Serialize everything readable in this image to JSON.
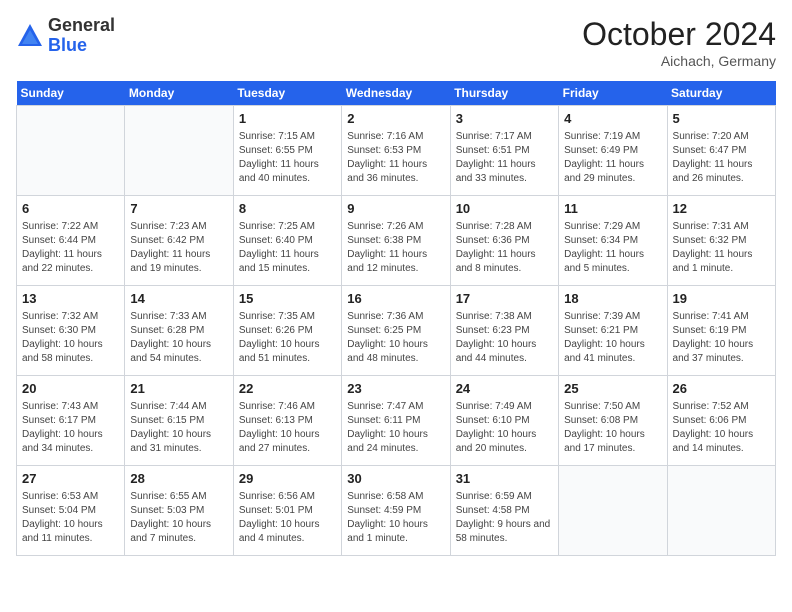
{
  "header": {
    "logo_general": "General",
    "logo_blue": "Blue",
    "month_title": "October 2024",
    "location": "Aichach, Germany"
  },
  "days_of_week": [
    "Sunday",
    "Monday",
    "Tuesday",
    "Wednesday",
    "Thursday",
    "Friday",
    "Saturday"
  ],
  "weeks": [
    [
      {
        "day": "",
        "info": ""
      },
      {
        "day": "",
        "info": ""
      },
      {
        "day": "1",
        "info": "Sunrise: 7:15 AM\nSunset: 6:55 PM\nDaylight: 11 hours and 40 minutes."
      },
      {
        "day": "2",
        "info": "Sunrise: 7:16 AM\nSunset: 6:53 PM\nDaylight: 11 hours and 36 minutes."
      },
      {
        "day": "3",
        "info": "Sunrise: 7:17 AM\nSunset: 6:51 PM\nDaylight: 11 hours and 33 minutes."
      },
      {
        "day": "4",
        "info": "Sunrise: 7:19 AM\nSunset: 6:49 PM\nDaylight: 11 hours and 29 minutes."
      },
      {
        "day": "5",
        "info": "Sunrise: 7:20 AM\nSunset: 6:47 PM\nDaylight: 11 hours and 26 minutes."
      }
    ],
    [
      {
        "day": "6",
        "info": "Sunrise: 7:22 AM\nSunset: 6:44 PM\nDaylight: 11 hours and 22 minutes."
      },
      {
        "day": "7",
        "info": "Sunrise: 7:23 AM\nSunset: 6:42 PM\nDaylight: 11 hours and 19 minutes."
      },
      {
        "day": "8",
        "info": "Sunrise: 7:25 AM\nSunset: 6:40 PM\nDaylight: 11 hours and 15 minutes."
      },
      {
        "day": "9",
        "info": "Sunrise: 7:26 AM\nSunset: 6:38 PM\nDaylight: 11 hours and 12 minutes."
      },
      {
        "day": "10",
        "info": "Sunrise: 7:28 AM\nSunset: 6:36 PM\nDaylight: 11 hours and 8 minutes."
      },
      {
        "day": "11",
        "info": "Sunrise: 7:29 AM\nSunset: 6:34 PM\nDaylight: 11 hours and 5 minutes."
      },
      {
        "day": "12",
        "info": "Sunrise: 7:31 AM\nSunset: 6:32 PM\nDaylight: 11 hours and 1 minute."
      }
    ],
    [
      {
        "day": "13",
        "info": "Sunrise: 7:32 AM\nSunset: 6:30 PM\nDaylight: 10 hours and 58 minutes."
      },
      {
        "day": "14",
        "info": "Sunrise: 7:33 AM\nSunset: 6:28 PM\nDaylight: 10 hours and 54 minutes."
      },
      {
        "day": "15",
        "info": "Sunrise: 7:35 AM\nSunset: 6:26 PM\nDaylight: 10 hours and 51 minutes."
      },
      {
        "day": "16",
        "info": "Sunrise: 7:36 AM\nSunset: 6:25 PM\nDaylight: 10 hours and 48 minutes."
      },
      {
        "day": "17",
        "info": "Sunrise: 7:38 AM\nSunset: 6:23 PM\nDaylight: 10 hours and 44 minutes."
      },
      {
        "day": "18",
        "info": "Sunrise: 7:39 AM\nSunset: 6:21 PM\nDaylight: 10 hours and 41 minutes."
      },
      {
        "day": "19",
        "info": "Sunrise: 7:41 AM\nSunset: 6:19 PM\nDaylight: 10 hours and 37 minutes."
      }
    ],
    [
      {
        "day": "20",
        "info": "Sunrise: 7:43 AM\nSunset: 6:17 PM\nDaylight: 10 hours and 34 minutes."
      },
      {
        "day": "21",
        "info": "Sunrise: 7:44 AM\nSunset: 6:15 PM\nDaylight: 10 hours and 31 minutes."
      },
      {
        "day": "22",
        "info": "Sunrise: 7:46 AM\nSunset: 6:13 PM\nDaylight: 10 hours and 27 minutes."
      },
      {
        "day": "23",
        "info": "Sunrise: 7:47 AM\nSunset: 6:11 PM\nDaylight: 10 hours and 24 minutes."
      },
      {
        "day": "24",
        "info": "Sunrise: 7:49 AM\nSunset: 6:10 PM\nDaylight: 10 hours and 20 minutes."
      },
      {
        "day": "25",
        "info": "Sunrise: 7:50 AM\nSunset: 6:08 PM\nDaylight: 10 hours and 17 minutes."
      },
      {
        "day": "26",
        "info": "Sunrise: 7:52 AM\nSunset: 6:06 PM\nDaylight: 10 hours and 14 minutes."
      }
    ],
    [
      {
        "day": "27",
        "info": "Sunrise: 6:53 AM\nSunset: 5:04 PM\nDaylight: 10 hours and 11 minutes."
      },
      {
        "day": "28",
        "info": "Sunrise: 6:55 AM\nSunset: 5:03 PM\nDaylight: 10 hours and 7 minutes."
      },
      {
        "day": "29",
        "info": "Sunrise: 6:56 AM\nSunset: 5:01 PM\nDaylight: 10 hours and 4 minutes."
      },
      {
        "day": "30",
        "info": "Sunrise: 6:58 AM\nSunset: 4:59 PM\nDaylight: 10 hours and 1 minute."
      },
      {
        "day": "31",
        "info": "Sunrise: 6:59 AM\nSunset: 4:58 PM\nDaylight: 9 hours and 58 minutes."
      },
      {
        "day": "",
        "info": ""
      },
      {
        "day": "",
        "info": ""
      }
    ]
  ]
}
